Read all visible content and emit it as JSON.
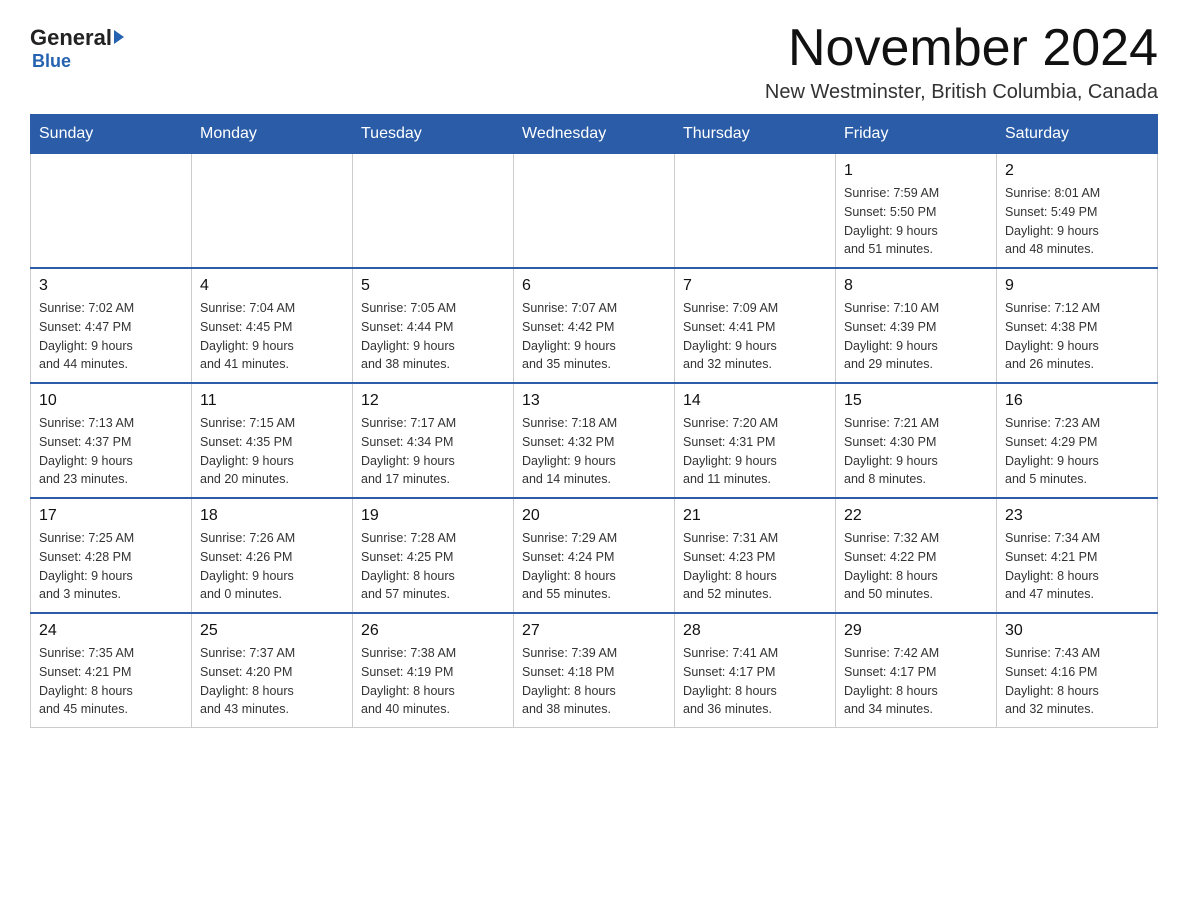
{
  "header": {
    "logo_general": "General",
    "logo_blue": "Blue",
    "title": "November 2024",
    "subtitle": "New Westminster, British Columbia, Canada"
  },
  "weekdays": [
    "Sunday",
    "Monday",
    "Tuesday",
    "Wednesday",
    "Thursday",
    "Friday",
    "Saturday"
  ],
  "weeks": [
    {
      "days": [
        {
          "num": "",
          "info": ""
        },
        {
          "num": "",
          "info": ""
        },
        {
          "num": "",
          "info": ""
        },
        {
          "num": "",
          "info": ""
        },
        {
          "num": "",
          "info": ""
        },
        {
          "num": "1",
          "info": "Sunrise: 7:59 AM\nSunset: 5:50 PM\nDaylight: 9 hours\nand 51 minutes."
        },
        {
          "num": "2",
          "info": "Sunrise: 8:01 AM\nSunset: 5:49 PM\nDaylight: 9 hours\nand 48 minutes."
        }
      ]
    },
    {
      "days": [
        {
          "num": "3",
          "info": "Sunrise: 7:02 AM\nSunset: 4:47 PM\nDaylight: 9 hours\nand 44 minutes."
        },
        {
          "num": "4",
          "info": "Sunrise: 7:04 AM\nSunset: 4:45 PM\nDaylight: 9 hours\nand 41 minutes."
        },
        {
          "num": "5",
          "info": "Sunrise: 7:05 AM\nSunset: 4:44 PM\nDaylight: 9 hours\nand 38 minutes."
        },
        {
          "num": "6",
          "info": "Sunrise: 7:07 AM\nSunset: 4:42 PM\nDaylight: 9 hours\nand 35 minutes."
        },
        {
          "num": "7",
          "info": "Sunrise: 7:09 AM\nSunset: 4:41 PM\nDaylight: 9 hours\nand 32 minutes."
        },
        {
          "num": "8",
          "info": "Sunrise: 7:10 AM\nSunset: 4:39 PM\nDaylight: 9 hours\nand 29 minutes."
        },
        {
          "num": "9",
          "info": "Sunrise: 7:12 AM\nSunset: 4:38 PM\nDaylight: 9 hours\nand 26 minutes."
        }
      ]
    },
    {
      "days": [
        {
          "num": "10",
          "info": "Sunrise: 7:13 AM\nSunset: 4:37 PM\nDaylight: 9 hours\nand 23 minutes."
        },
        {
          "num": "11",
          "info": "Sunrise: 7:15 AM\nSunset: 4:35 PM\nDaylight: 9 hours\nand 20 minutes."
        },
        {
          "num": "12",
          "info": "Sunrise: 7:17 AM\nSunset: 4:34 PM\nDaylight: 9 hours\nand 17 minutes."
        },
        {
          "num": "13",
          "info": "Sunrise: 7:18 AM\nSunset: 4:32 PM\nDaylight: 9 hours\nand 14 minutes."
        },
        {
          "num": "14",
          "info": "Sunrise: 7:20 AM\nSunset: 4:31 PM\nDaylight: 9 hours\nand 11 minutes."
        },
        {
          "num": "15",
          "info": "Sunrise: 7:21 AM\nSunset: 4:30 PM\nDaylight: 9 hours\nand 8 minutes."
        },
        {
          "num": "16",
          "info": "Sunrise: 7:23 AM\nSunset: 4:29 PM\nDaylight: 9 hours\nand 5 minutes."
        }
      ]
    },
    {
      "days": [
        {
          "num": "17",
          "info": "Sunrise: 7:25 AM\nSunset: 4:28 PM\nDaylight: 9 hours\nand 3 minutes."
        },
        {
          "num": "18",
          "info": "Sunrise: 7:26 AM\nSunset: 4:26 PM\nDaylight: 9 hours\nand 0 minutes."
        },
        {
          "num": "19",
          "info": "Sunrise: 7:28 AM\nSunset: 4:25 PM\nDaylight: 8 hours\nand 57 minutes."
        },
        {
          "num": "20",
          "info": "Sunrise: 7:29 AM\nSunset: 4:24 PM\nDaylight: 8 hours\nand 55 minutes."
        },
        {
          "num": "21",
          "info": "Sunrise: 7:31 AM\nSunset: 4:23 PM\nDaylight: 8 hours\nand 52 minutes."
        },
        {
          "num": "22",
          "info": "Sunrise: 7:32 AM\nSunset: 4:22 PM\nDaylight: 8 hours\nand 50 minutes."
        },
        {
          "num": "23",
          "info": "Sunrise: 7:34 AM\nSunset: 4:21 PM\nDaylight: 8 hours\nand 47 minutes."
        }
      ]
    },
    {
      "days": [
        {
          "num": "24",
          "info": "Sunrise: 7:35 AM\nSunset: 4:21 PM\nDaylight: 8 hours\nand 45 minutes."
        },
        {
          "num": "25",
          "info": "Sunrise: 7:37 AM\nSunset: 4:20 PM\nDaylight: 8 hours\nand 43 minutes."
        },
        {
          "num": "26",
          "info": "Sunrise: 7:38 AM\nSunset: 4:19 PM\nDaylight: 8 hours\nand 40 minutes."
        },
        {
          "num": "27",
          "info": "Sunrise: 7:39 AM\nSunset: 4:18 PM\nDaylight: 8 hours\nand 38 minutes."
        },
        {
          "num": "28",
          "info": "Sunrise: 7:41 AM\nSunset: 4:17 PM\nDaylight: 8 hours\nand 36 minutes."
        },
        {
          "num": "29",
          "info": "Sunrise: 7:42 AM\nSunset: 4:17 PM\nDaylight: 8 hours\nand 34 minutes."
        },
        {
          "num": "30",
          "info": "Sunrise: 7:43 AM\nSunset: 4:16 PM\nDaylight: 8 hours\nand 32 minutes."
        }
      ]
    }
  ]
}
